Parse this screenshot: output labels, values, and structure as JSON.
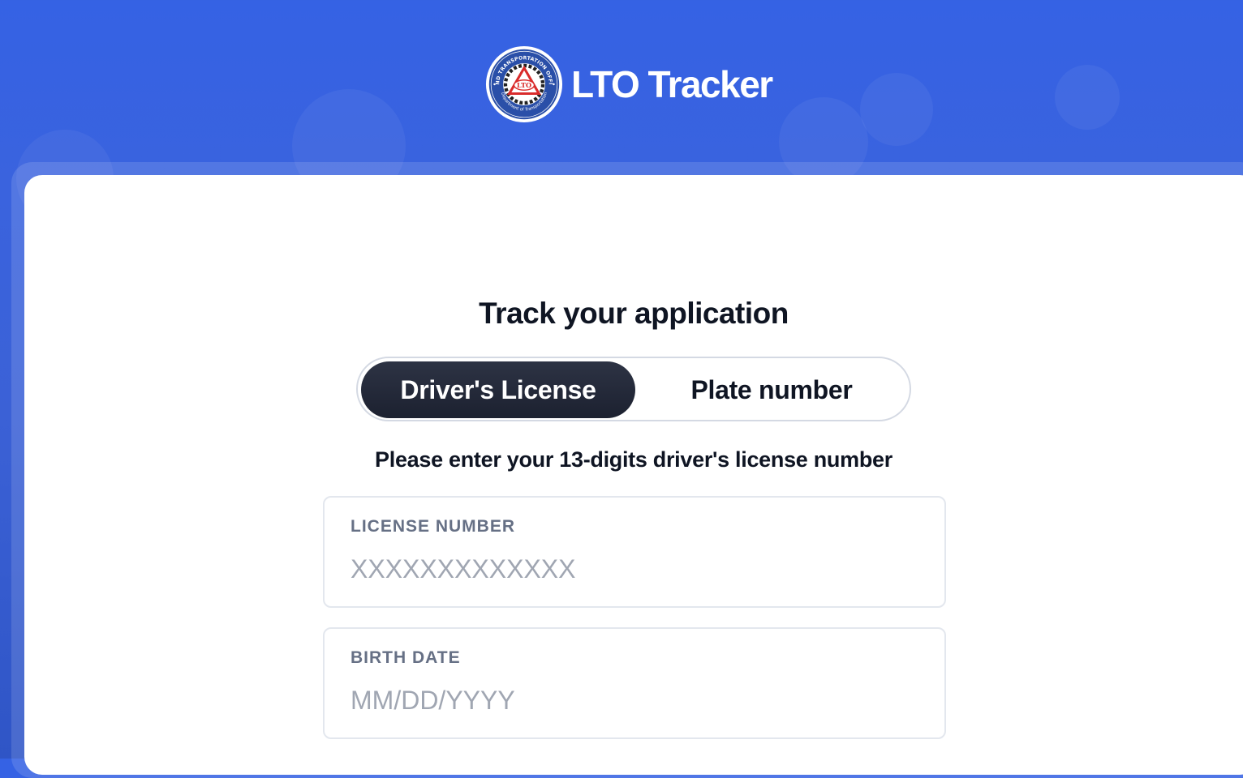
{
  "brand": {
    "name": "LTO Tracker",
    "logo_ring_text_top": "LAND TRANSPORTATION OFFICE",
    "logo_ring_text_bottom": "Department of Transportation",
    "logo_center_text": "LTO"
  },
  "form": {
    "title": "Track your application",
    "tabs": [
      {
        "label": "Driver's License",
        "active": true
      },
      {
        "label": "Plate number",
        "active": false
      }
    ],
    "instruction": "Please enter your 13-digits driver's license number",
    "fields": {
      "license": {
        "label": "LICENSE NUMBER",
        "value": "",
        "placeholder": "XXXXXXXXXXXXX"
      },
      "birth_date": {
        "label": "BIRTH DATE",
        "value": "",
        "placeholder": "MM/DD/YYYY"
      }
    }
  },
  "colors": {
    "background": "#3562e4",
    "active_tab": "#1c2130",
    "text_dark": "#0f1523",
    "label_gray": "#667085",
    "placeholder_gray": "#a0a6b2",
    "logo_red": "#d92b2b",
    "logo_blue": "#2a4fa8"
  }
}
